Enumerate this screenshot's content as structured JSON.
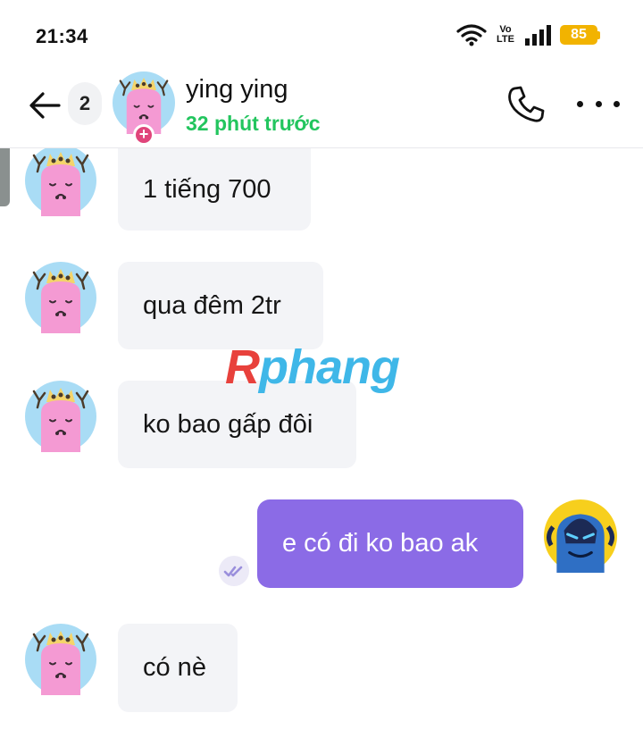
{
  "status_bar": {
    "time": "21:34",
    "volte_top": "Vo",
    "volte_bottom": "LTE",
    "battery": "85",
    "icons": [
      "wifi-icon",
      "volte-icon",
      "signal-icon",
      "battery-icon"
    ],
    "battery_color": "#f2b300"
  },
  "header": {
    "unread_count": "2",
    "contact_name": "ying ying",
    "contact_status": "32 phút trước",
    "status_color": "#22c55e",
    "add_badge": "+"
  },
  "messages": [
    {
      "direction": "incoming",
      "text": "1 tiếng 700"
    },
    {
      "direction": "incoming",
      "text": "qua đêm 2tr"
    },
    {
      "direction": "incoming",
      "text": "ko bao gấp đôi"
    },
    {
      "direction": "outgoing",
      "text": "e có đi ko bao ak",
      "status_icon": "seen-check-icon"
    },
    {
      "direction": "incoming",
      "text": "có nè"
    }
  ],
  "watermark": {
    "part1": "R",
    "part2": "phang"
  },
  "colors": {
    "outgoing_bubble": "#8b6be6",
    "incoming_bubble": "#f3f4f7"
  }
}
